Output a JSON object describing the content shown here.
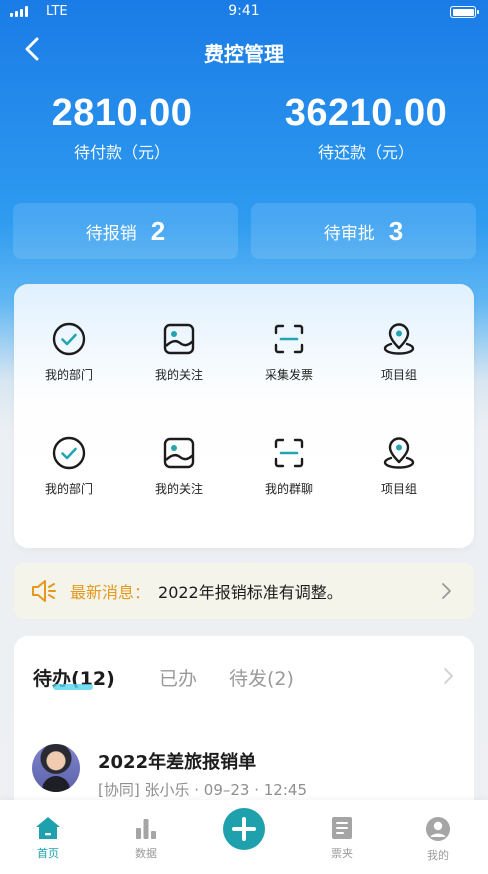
{
  "status_bar": {
    "carrier": "LTE",
    "time": "9:41"
  },
  "nav": {
    "title": "费控管理"
  },
  "summary": [
    {
      "value": "2810.00",
      "label": "待付款（元）"
    },
    {
      "value": "36210.00",
      "label": "待还款（元）"
    }
  ],
  "pending": [
    {
      "label": "待报销",
      "count": "2"
    },
    {
      "label": "待审批",
      "count": "3"
    }
  ],
  "shortcuts": [
    {
      "label": "我的部门",
      "icon": "check-circle-icon"
    },
    {
      "label": "我的关注",
      "icon": "image-icon"
    },
    {
      "label": "采集发票",
      "icon": "scan-icon"
    },
    {
      "label": "项目组",
      "icon": "location-pin-icon"
    },
    {
      "label": "我的部门",
      "icon": "check-circle-icon"
    },
    {
      "label": "我的关注",
      "icon": "image-icon"
    },
    {
      "label": "我的群聊",
      "icon": "scan-icon"
    },
    {
      "label": "项目组",
      "icon": "location-pin-icon"
    }
  ],
  "notice": {
    "tag": "最新消息：",
    "message": "2022年报销标准有调整。"
  },
  "tasks": {
    "tabs": [
      {
        "label": "待办(12)",
        "active": true
      },
      {
        "label": "已办",
        "active": false
      },
      {
        "label": "待发(2)",
        "active": false
      }
    ],
    "items": [
      {
        "title": "2022年差旅报销单",
        "meta": "[协同] 张小乐 · 09–23 · 12:45"
      }
    ]
  },
  "tabbar": [
    {
      "label": "首页",
      "icon": "home-icon",
      "active": true
    },
    {
      "label": "数据",
      "icon": "bar-chart-icon",
      "active": false
    },
    {
      "label": "",
      "icon": "plus-icon",
      "active": false
    },
    {
      "label": "票夹",
      "icon": "book-icon",
      "active": false
    },
    {
      "label": "我的",
      "icon": "profile-icon",
      "active": false
    }
  ],
  "colors": {
    "primary": "#1a7be6",
    "accent": "#1ea1ad",
    "notice_tag": "#e5981b"
  }
}
